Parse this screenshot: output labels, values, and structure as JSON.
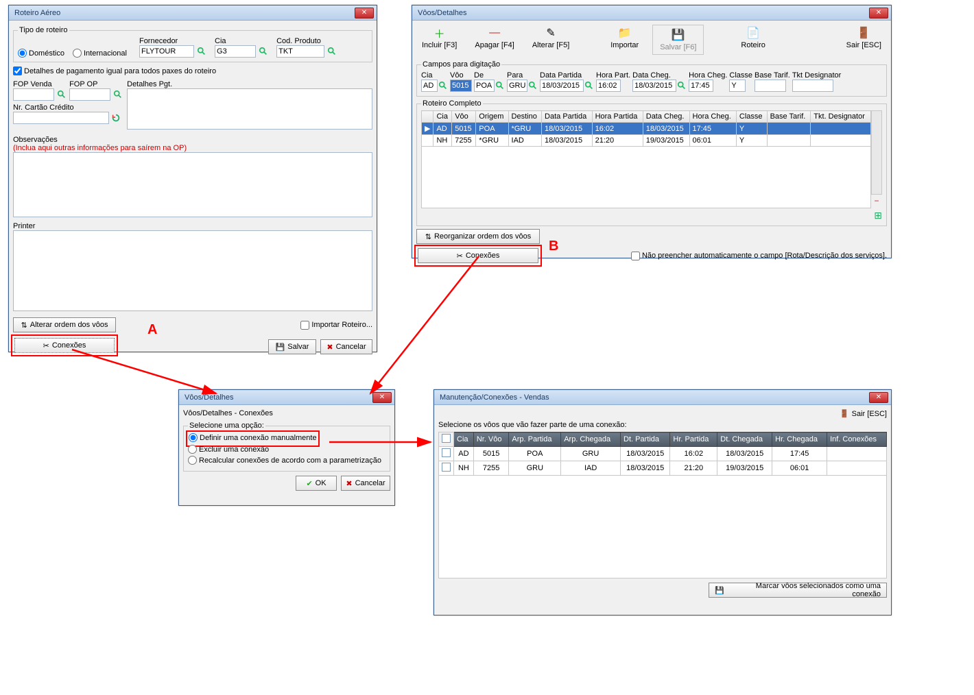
{
  "window1": {
    "title": "Roteiro Aéreo",
    "tipo_roteiro_legend": "Tipo de roteiro",
    "radio_domestico": "Doméstico",
    "radio_internacional": "Internacional",
    "fornecedor_label": "Fornecedor",
    "fornecedor_value": "FLYTOUR",
    "cia_label": "Cia",
    "cia_value": "G3",
    "cod_produto_label": "Cod. Produto",
    "cod_produto_value": "TKT",
    "detalhes_pgto_chk": "Detalhes de pagamento igual para todos paxes do roteiro",
    "fop_venda_label": "FOP Venda",
    "fop_op_label": "FOP OP",
    "detalhes_pgt_label": "Detalhes Pgt.",
    "nr_cartao_label": "Nr. Cartão Crédito",
    "observacoes_label": "Observações",
    "observacoes_hint": "(Inclua aqui outras informações para saírem na OP)",
    "printer_label": "Printer",
    "alterar_ordem": "Alterar ordem dos vôos",
    "importar_roteiro": "Importar Roteiro...",
    "conexoes": "Conexões",
    "salvar": "Salvar",
    "cancelar": "Cancelar"
  },
  "window2": {
    "title": "Vôos/Detalhes",
    "incluir": "Incluir [F3]",
    "apagar": "Apagar [F4]",
    "alterar": "Alterar [F5]",
    "importar": "Importar",
    "salvar": "Salvar [F6]",
    "roteiro": "Roteiro",
    "sair": "Sair [ESC]",
    "campos_legend": "Campos para digitação",
    "field_cia": "Cia",
    "field_cia_val": "AD",
    "field_voo": "Vôo",
    "field_voo_val": "5015",
    "field_de": "De",
    "field_de_val": "POA",
    "field_para": "Para",
    "field_para_val": "GRU",
    "field_data_partida": "Data Partida",
    "field_data_partida_val": "18/03/2015",
    "field_hora_part": "Hora Part.",
    "field_hora_part_val": "16:02",
    "field_data_cheg": "Data Cheg.",
    "field_data_cheg_val": "18/03/2015",
    "field_hora_cheg": "Hora Cheg.",
    "field_hora_cheg_val": "17:45",
    "field_classe": "Classe",
    "field_classe_val": "Y",
    "field_base_tarif": "Base Tarif.",
    "field_tkt": "Tkt Designator",
    "roteiro_completo_legend": "Roteiro Completo",
    "columns": {
      "cia": "Cia",
      "voo": "Vôo",
      "origem": "Origem",
      "destino": "Destino",
      "data_partida": "Data Partida",
      "hora_partida": "Hora Partida",
      "data_cheg": "Data Cheg.",
      "hora_cheg": "Hora Cheg.",
      "classe": "Classe",
      "base_tarif": "Base Tarif.",
      "tkt": "Tkt. Designator"
    },
    "rows": [
      {
        "cia": "AD",
        "voo": "5015",
        "origem": "POA",
        "destino": "*GRU",
        "dp": "18/03/2015",
        "hp": "16:02",
        "dc": "18/03/2015",
        "hc": "17:45",
        "classe": "Y",
        "bt": "",
        "tkt": ""
      },
      {
        "cia": "NH",
        "voo": "7255",
        "origem": "*GRU",
        "destino": "IAD",
        "dp": "18/03/2015",
        "hp": "21:20",
        "dc": "19/03/2015",
        "hc": "06:01",
        "classe": "Y",
        "bt": "",
        "tkt": ""
      }
    ],
    "reorganizar": "Reorganizar ordem dos vôos",
    "conexoes": "Conexões",
    "nao_preencher": "Não preencher automaticamente o campo [Rota/Descrição dos serviços]."
  },
  "window3": {
    "title": "Vôos/Detalhes",
    "subtitle": "Vôos/Detalhes - Conexões",
    "selecione": "Selecione uma opção:",
    "opt1": "Definir uma conexão manualmente",
    "opt2": "Excluir uma conexão",
    "opt3": "Recalcular conexões de acordo com a parametrização",
    "ok": "OK",
    "cancelar": "Cancelar"
  },
  "window4": {
    "title": "Manutenção/Conexões - Vendas",
    "sair": "Sair [ESC]",
    "selecione": "Selecione os vôos que vão fazer parte de uma conexão:",
    "columns": {
      "cia": "Cia",
      "nrvoo": "Nr. Vôo",
      "arp_partida": "Arp. Partida",
      "arp_chegada": "Arp. Chegada",
      "dt_partida": "Dt. Partida",
      "hr_partida": "Hr. Partida",
      "dt_chegada": "Dt. Chegada",
      "hr_chegada": "Hr. Chegada",
      "inf": "Inf. Conexões"
    },
    "rows": [
      {
        "cia": "AD",
        "nrvoo": "5015",
        "arpp": "POA",
        "arpc": "GRU",
        "dtp": "18/03/2015",
        "hrp": "16:02",
        "dtc": "18/03/2015",
        "hrc": "17:45",
        "inf": ""
      },
      {
        "cia": "NH",
        "nrvoo": "7255",
        "arpp": "GRU",
        "arpc": "IAD",
        "dtp": "18/03/2015",
        "hrp": "21:20",
        "dtc": "19/03/2015",
        "hrc": "06:01",
        "inf": ""
      }
    ],
    "marcar": "Marcar vôos selecionados como uma conexão"
  },
  "annotations": {
    "a": "A",
    "b": "B"
  }
}
